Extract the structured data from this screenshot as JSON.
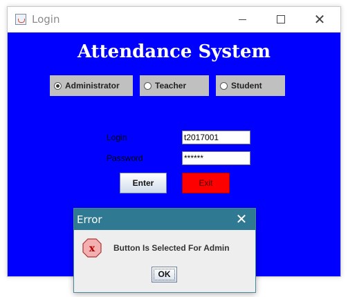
{
  "window": {
    "title": "Login",
    "icon": "java-cup-icon"
  },
  "app": {
    "heading": "Attendance System",
    "roles": [
      {
        "label": "Administrator",
        "selected": true
      },
      {
        "label": "Teacher",
        "selected": false
      },
      {
        "label": "Student",
        "selected": false
      }
    ],
    "login_label": "Login",
    "login_value": "t2017001",
    "password_label": "Password",
    "password_value": "******",
    "enter_label": "Enter",
    "exit_label": "Exit"
  },
  "dialog": {
    "title": "Error",
    "message": "Button Is Selected For Admin",
    "ok_label": "OK",
    "icon": "error-icon"
  },
  "colors": {
    "content_bg": "#0000ff",
    "exit_bg": "#ff0000",
    "dialog_titlebar": "#2f7a92",
    "radio_bg": "#c0c0c0"
  }
}
